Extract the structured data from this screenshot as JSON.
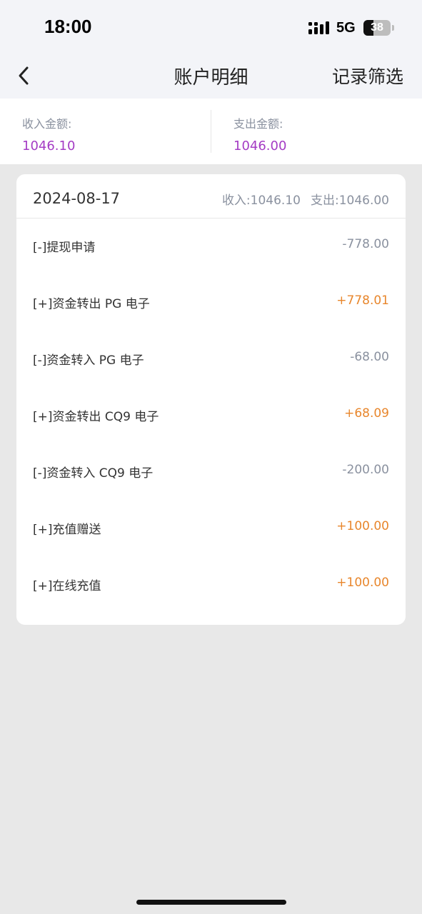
{
  "status_bar": {
    "time": "18:00",
    "network": "5G",
    "battery_text": "38",
    "battery_level": 0.38,
    "icons": [
      "signal-icon",
      "battery-icon"
    ]
  },
  "header": {
    "back_icon": "chevron-left-icon",
    "title": "账户明细",
    "filter_label": "记录筛选"
  },
  "summary": {
    "income_label": "收入金额:",
    "income_value": "1046.10",
    "expense_label": "支出金额:",
    "expense_value": "1046.00"
  },
  "group": {
    "date": "2024-08-17",
    "income_total": "收入:1046.10",
    "expense_total": "支出:1046.00"
  },
  "records": [
    {
      "label": "[-]提现申请",
      "amount": "-778.00"
    },
    {
      "label": "[+]资金转出 PG 电子",
      "amount": "+778.01"
    },
    {
      "label": "[-]资金转入 PG 电子",
      "amount": "-68.00"
    },
    {
      "label": "[+]资金转出 CQ9 电子",
      "amount": "+68.09"
    },
    {
      "label": "[-]资金转入 CQ9 电子",
      "amount": "-200.00"
    },
    {
      "label": "[+]充值赠送",
      "amount": "+100.00"
    },
    {
      "label": "[+]在线充值",
      "amount": "+100.00"
    }
  ],
  "colors": {
    "summary_value": "#a43cc4",
    "positive": "#e8862c",
    "negative": "#8a919f"
  }
}
